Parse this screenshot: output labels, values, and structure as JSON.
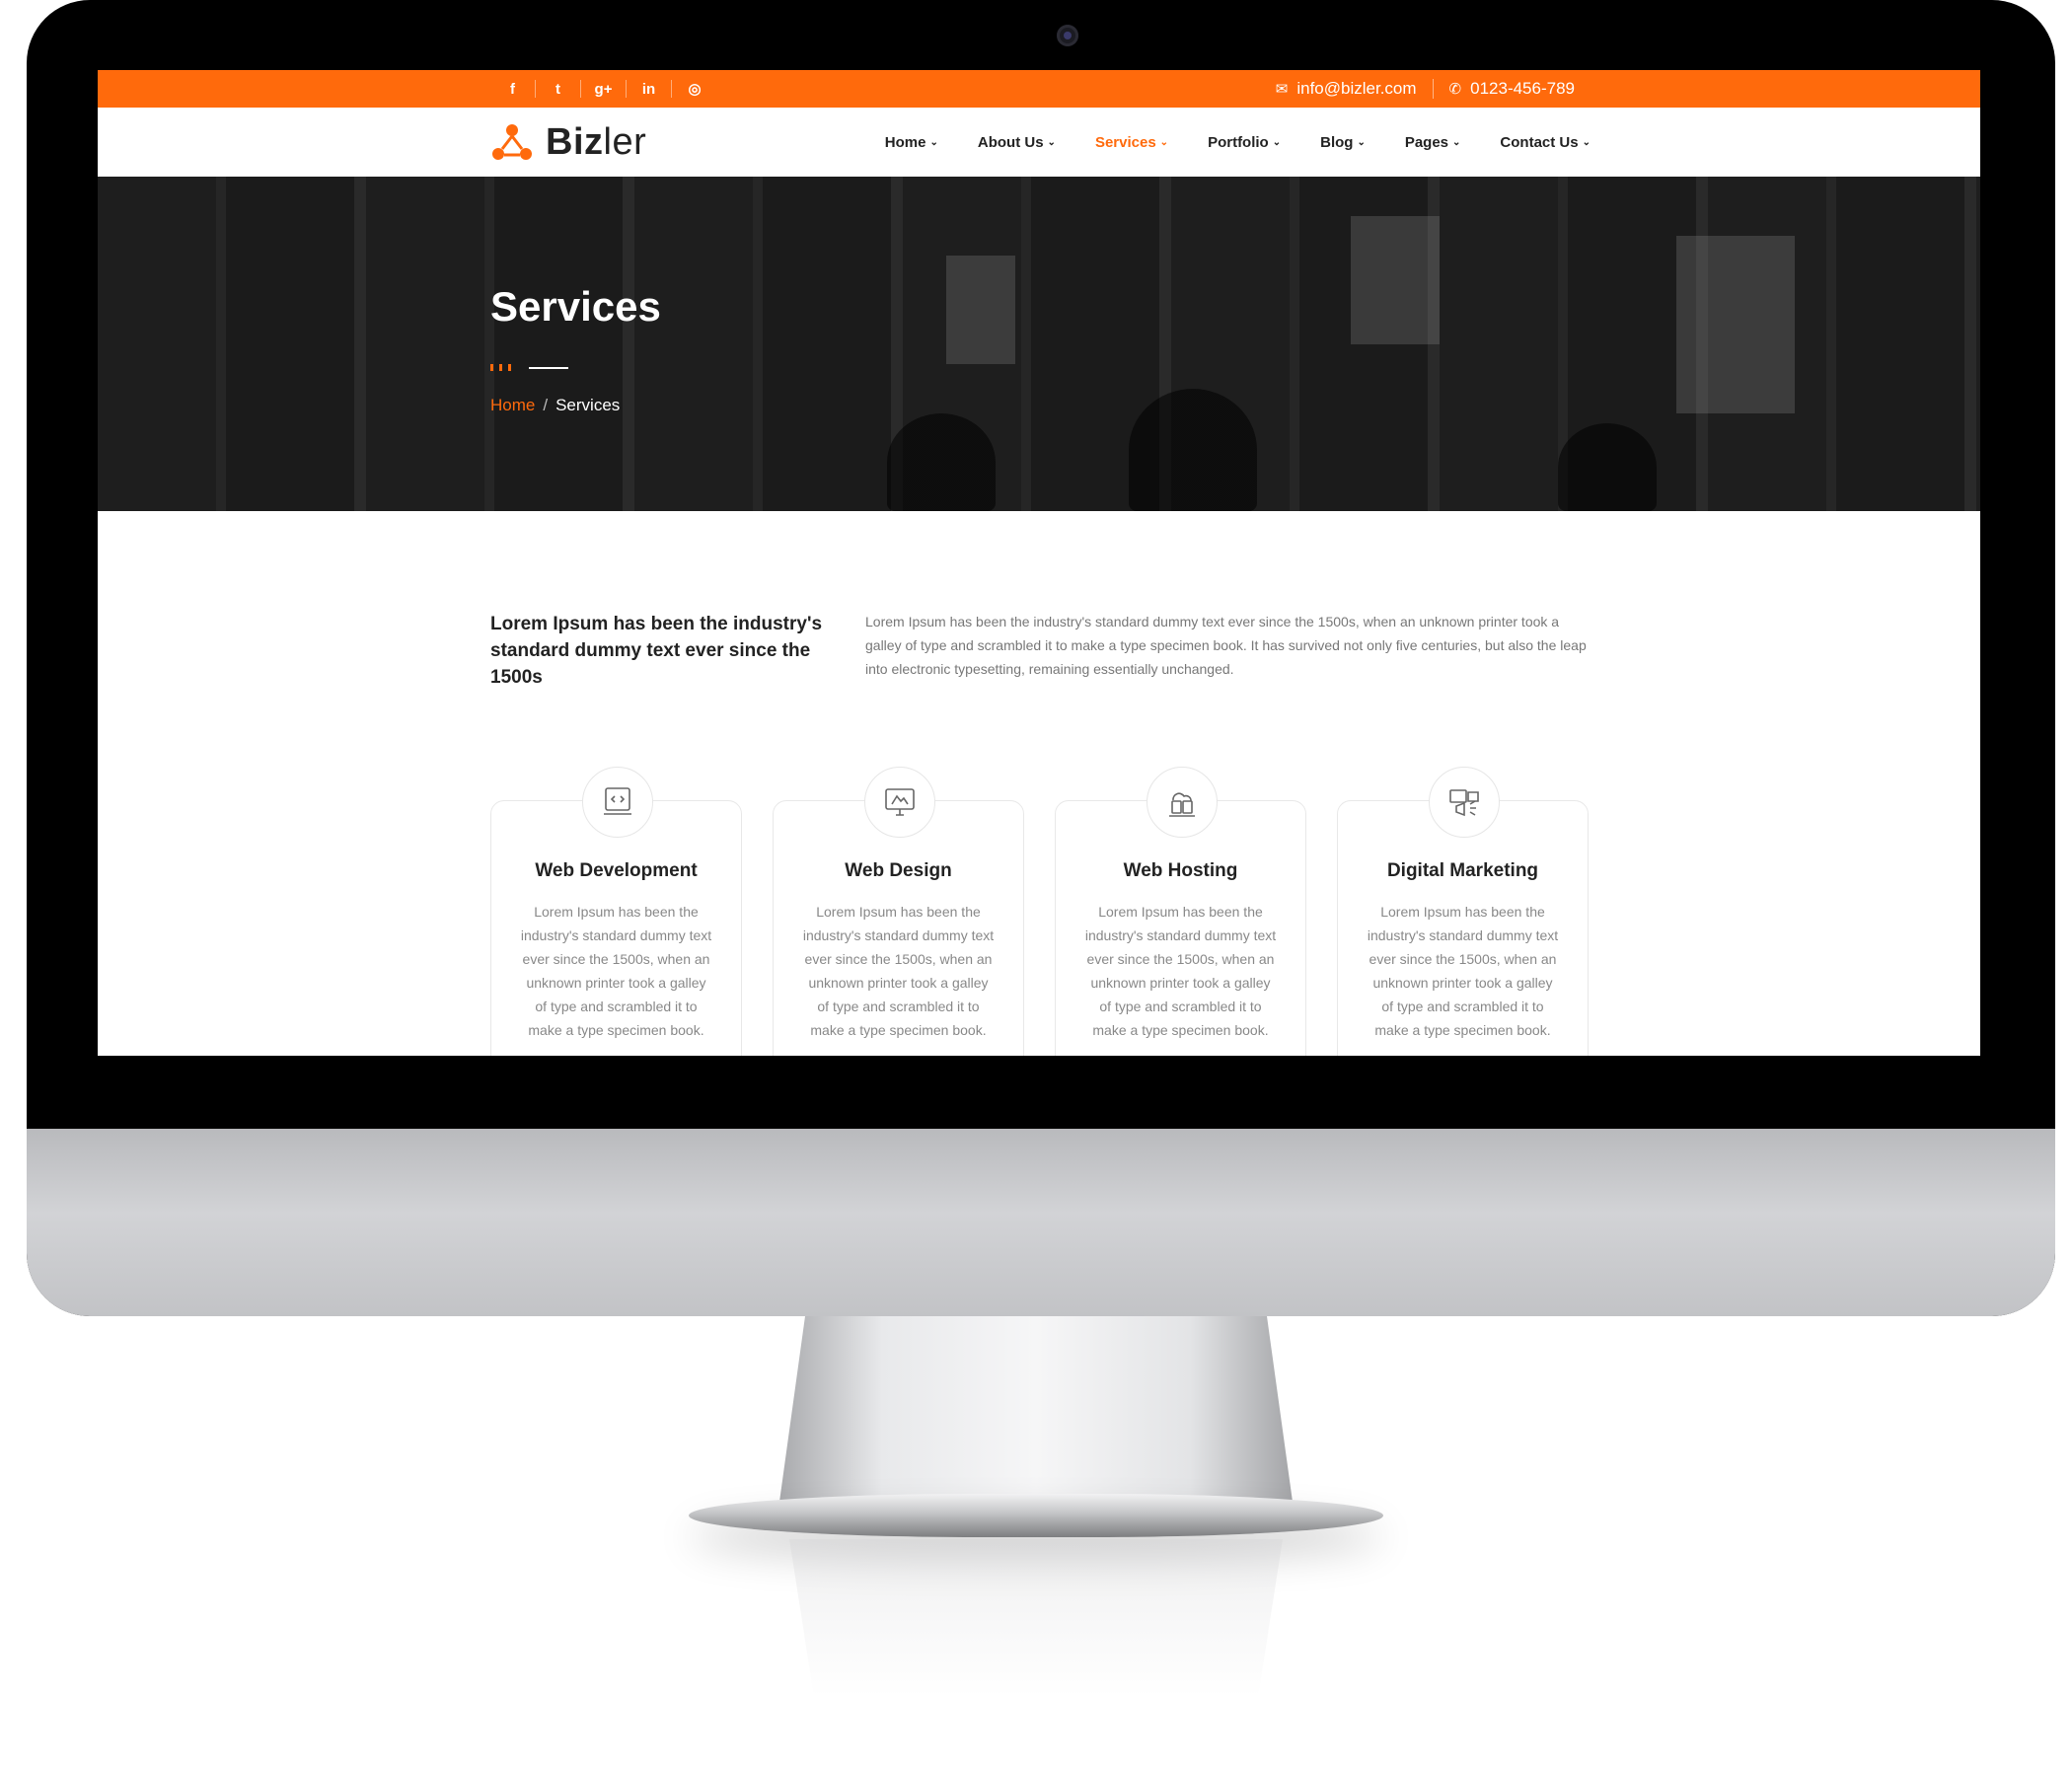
{
  "topbar": {
    "social": [
      {
        "icon": "facebook-icon",
        "glyph": "f"
      },
      {
        "icon": "twitter-icon",
        "glyph": "t"
      },
      {
        "icon": "google-plus-icon",
        "glyph": "g+"
      },
      {
        "icon": "linkedin-icon",
        "glyph": "in"
      },
      {
        "icon": "instagram-icon",
        "glyph": "◎"
      }
    ],
    "email": "info@bizler.com",
    "phone": "0123-456-789"
  },
  "brand": {
    "name_bold": "Biz",
    "name_light": "ler"
  },
  "nav": {
    "items": [
      {
        "label": "Home"
      },
      {
        "label": "About Us"
      },
      {
        "label": "Services",
        "active": true
      },
      {
        "label": "Portfolio"
      },
      {
        "label": "Blog"
      },
      {
        "label": "Pages"
      },
      {
        "label": "Contact Us"
      }
    ]
  },
  "hero": {
    "title": "Services",
    "breadcrumb": {
      "home": "Home",
      "separator": "/",
      "current": "Services"
    }
  },
  "intro": {
    "heading": "Lorem Ipsum has been the industry's standard dummy text ever since the 1500s",
    "text": "Lorem Ipsum has been the industry's standard dummy text ever since the 1500s, when an unknown printer took a galley of type and scrambled it to make a type specimen book. It has survived not only five centuries, but also the leap into electronic typesetting, remaining essentially unchanged."
  },
  "services": [
    {
      "title": "Web Development",
      "icon": "web-development-icon",
      "text": "Lorem Ipsum has been the industry's standard dummy text ever since the 1500s, when an unknown printer took a galley of type and scrambled it to make a type specimen book."
    },
    {
      "title": "Web Design",
      "icon": "web-design-icon",
      "text": "Lorem Ipsum has been the industry's standard dummy text ever since the 1500s, when an unknown printer took a galley of type and scrambled it to make a type specimen book."
    },
    {
      "title": "Web Hosting",
      "icon": "web-hosting-icon",
      "text": "Lorem Ipsum has been the industry's standard dummy text ever since the 1500s, when an unknown printer took a galley of type and scrambled it to make a type specimen book."
    },
    {
      "title": "Digital Marketing",
      "icon": "digital-marketing-icon",
      "text": "Lorem Ipsum has been the industry's standard dummy text ever since the 1500s, when an unknown printer took a galley of type and scrambled it to make a type specimen book."
    }
  ],
  "colors": {
    "accent": "#ff6a0c",
    "text_dark": "#222222",
    "text_muted": "#777777"
  }
}
